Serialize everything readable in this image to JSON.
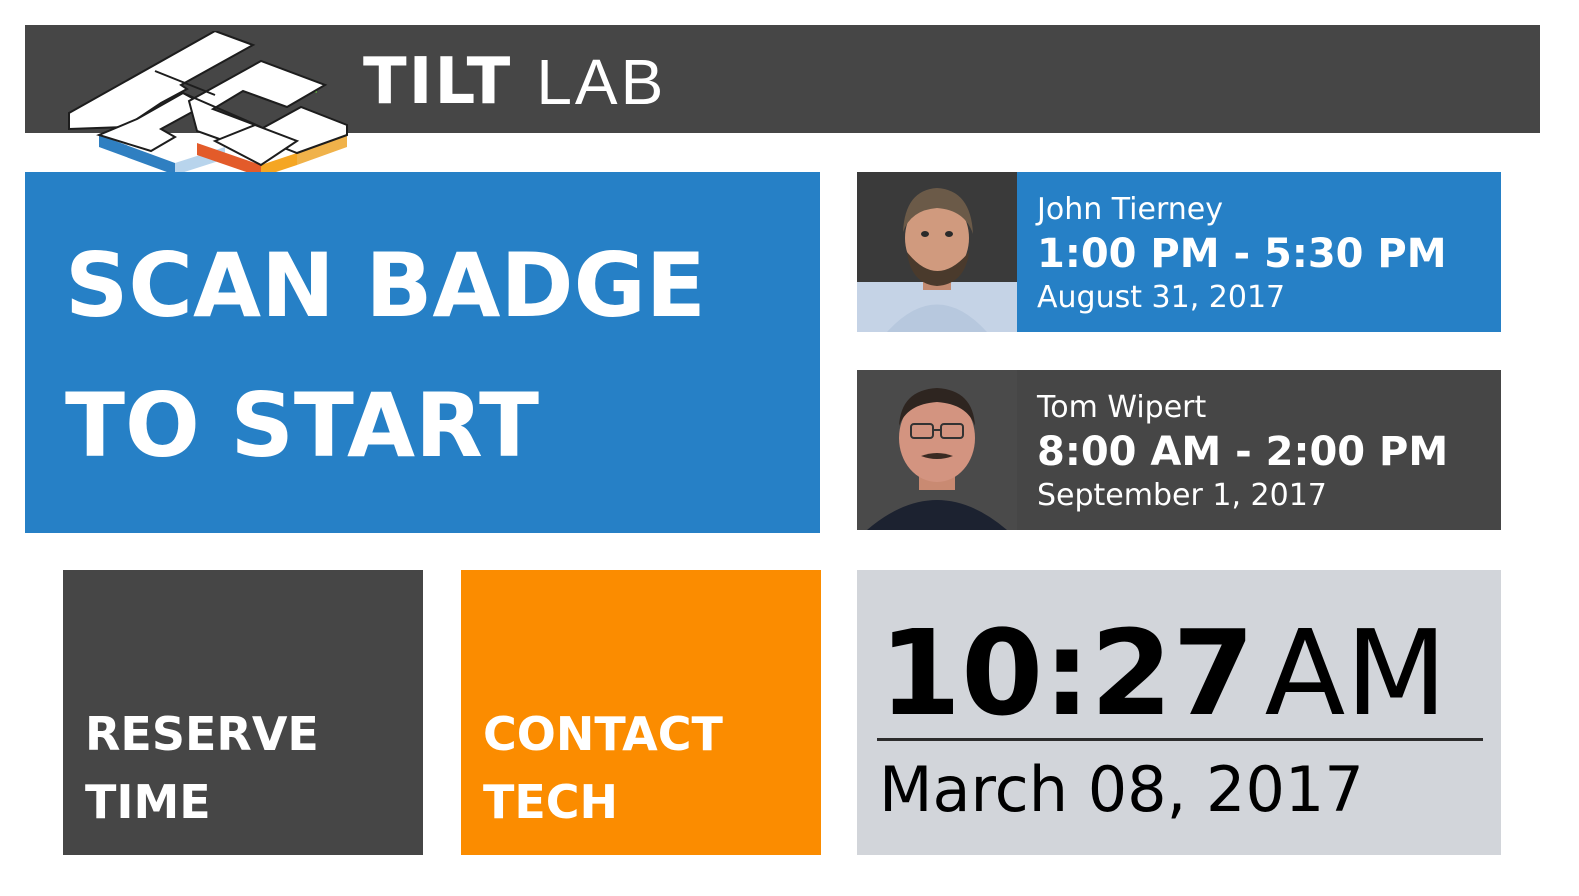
{
  "header": {
    "brand_bold": "TILT",
    "brand_light": "LAB",
    "logo_icon": "tilt-lab-logo"
  },
  "scan": {
    "line1": "SCAN BADGE",
    "line2": "TO START"
  },
  "techs": [
    {
      "name": "John Tierney",
      "time": "1:00 PM - 5:30 PM",
      "date": "August 31, 2017",
      "color": "#2680c6"
    },
    {
      "name": "Tom Wipert",
      "time": "8:00 AM - 2:00 PM",
      "date": "September 1, 2017",
      "color": "#464646"
    }
  ],
  "actions": {
    "reserve": {
      "line1": "RESERVE",
      "line2": "TIME",
      "color": "#464646"
    },
    "contact": {
      "line1": "CONTACT",
      "line2": "TECH",
      "color": "#fb8c00"
    }
  },
  "clock": {
    "time": "10:27",
    "ampm": "AM",
    "date": "March 08, 2017"
  },
  "colors": {
    "primary_blue": "#2680c6",
    "dark_gray": "#464646",
    "orange": "#fb8c00",
    "clock_bg": "#d2d5da"
  }
}
